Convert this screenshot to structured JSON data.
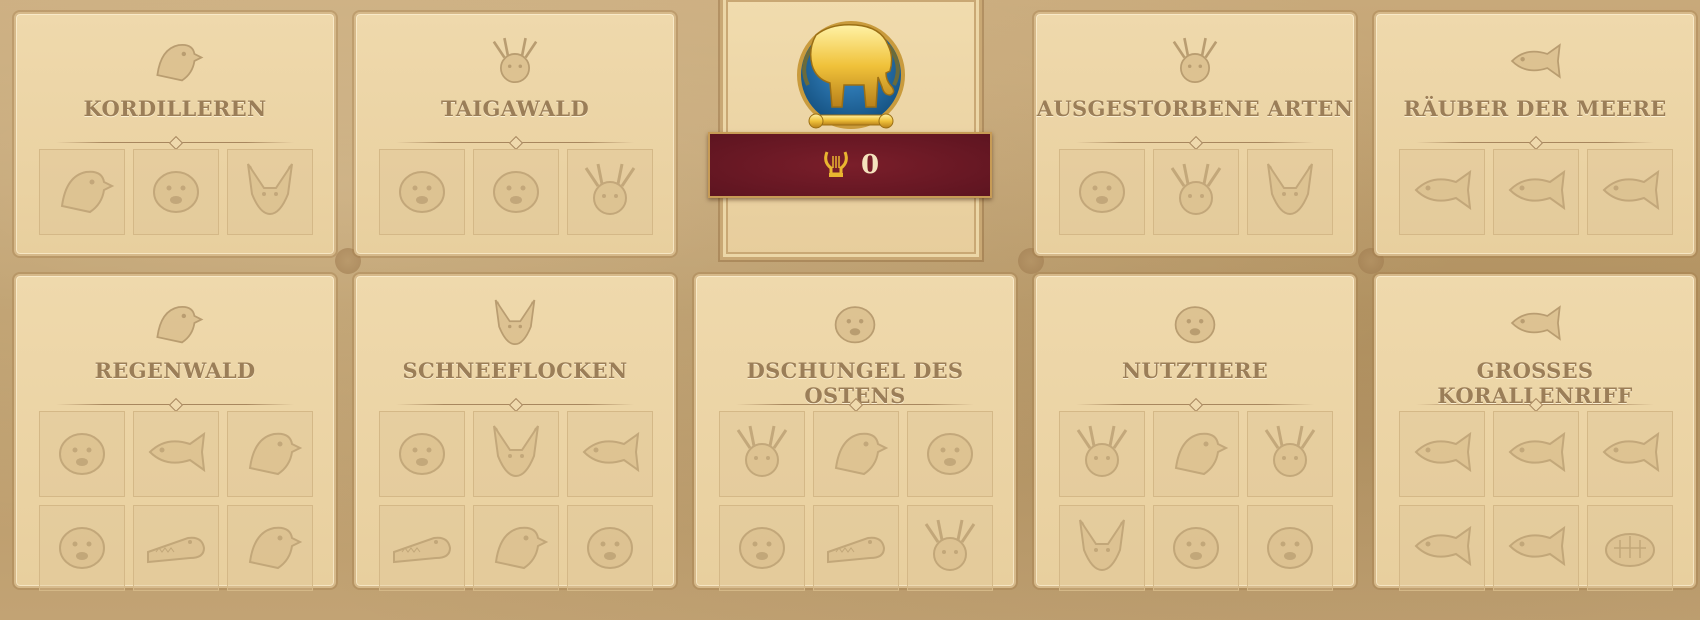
{
  "featured": {
    "icon": "golden-elephant-icon",
    "score_icon": "lyre-icon",
    "score": "0"
  },
  "colors": {
    "panel": "#efd9ac",
    "title": "#9b7e58",
    "banner": "#6b1925",
    "gold": "#e9b530"
  },
  "collections": [
    {
      "title": "KORDILLEREN",
      "icon": "condor-icon",
      "animals": [
        "condor-icon",
        "bear-icon",
        "llama-icon"
      ]
    },
    {
      "title": "TAIGAWALD",
      "icon": "moose-icon",
      "animals": [
        "bear-icon",
        "bear-icon",
        "moose-icon"
      ]
    },
    {
      "title": "AUSGESTORBENE ARTEN",
      "icon": "elk-icon",
      "animals": [
        "cave-bear-icon",
        "elk-icon",
        "wolf-icon"
      ]
    },
    {
      "title": "RÄUBER DER MEERE",
      "icon": "swordfish-icon",
      "animals": [
        "orca-icon",
        "swordfish-icon",
        "shark-icon"
      ]
    },
    {
      "title": "REGENWALD",
      "icon": "parrot-icon",
      "animals": [
        "panther-icon",
        "dolphin-icon",
        "pelican-icon",
        "jaguar-icon",
        "crocodile-icon",
        "parrot-icon"
      ]
    },
    {
      "title": "SCHNEEFLOCKEN",
      "icon": "fennec-icon",
      "animals": [
        "tiger-icon",
        "fennec-icon",
        "dolphin-icon",
        "crocodile-icon",
        "peacock-icon",
        "gorilla-icon"
      ]
    },
    {
      "title": "DSCHUNGEL DES OSTENS",
      "icon": "tiger-icon",
      "animals": [
        "deer-icon",
        "peacock-icon",
        "tiger-icon",
        "elephant-icon",
        "crocodile-icon",
        "buffalo-icon"
      ]
    },
    {
      "title": "NUTZTIERE",
      "icon": "sheep-icon",
      "animals": [
        "cow-icon",
        "chicken-icon",
        "goat-icon",
        "horse-icon",
        "pig-icon",
        "sheep-icon"
      ]
    },
    {
      "title": "GROSSES KORALLENRIFF",
      "icon": "lionfish-icon",
      "animals": [
        "dolphin-icon",
        "seahorse-icon",
        "lionfish-icon",
        "manta-icon",
        "pufferfish-icon",
        "turtle-icon"
      ]
    }
  ]
}
